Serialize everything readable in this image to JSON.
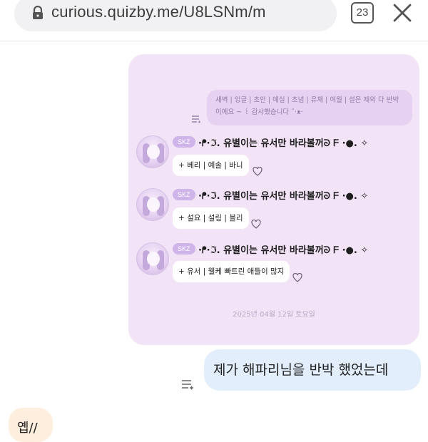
{
  "browser": {
    "url": "curious.quizby.me/U8LSNm/m",
    "tab_count": "23"
  },
  "attachment": {
    "top_bubble_text": "새벽 | 잉글 | 초안 | 예실 | 초념 | 유채 | 여월 | 설은 제외 다 반박 이에요 ~ ꒰ 감사했습니다 ˘·ᴥ·",
    "messages": [
      {
        "badge": "SKZ",
        "nickname": "·ᖰ·ℑ. 유별이는 유서만 바라볼꺼ᘐ ᖴ ·●. ✧",
        "reply": "+ 베리 | 예솔 | 바니"
      },
      {
        "badge": "SKZ",
        "nickname": "·ᖰ·ℑ. 유별이는 유서만 바라볼꺼ᘐ ᖴ ·●. ✧",
        "reply": "+ 설요 | 설링 | 블리"
      },
      {
        "badge": "SKZ",
        "nickname": "·ᖰ·ℑ. 유별이는 유서만 바라볼꺼ᘐ ᖴ ·●. ✧",
        "reply": "+ 유서 | 웰케 빠트린 애들이 많지"
      }
    ],
    "date": "2025년 04월 12일 토요일"
  },
  "chat": {
    "my_message": "제가 해파리님을 반박 했었는데",
    "their_message": "옙//"
  },
  "colors": {
    "card_bg": "#f3e3f7",
    "badge": "#cfb4ea",
    "my_bubble": "#e2eefc",
    "their_bubble": "#fdeedd"
  },
  "icons": [
    "lock-icon",
    "close-icon",
    "menu-icon",
    "heart-icon",
    "avatar"
  ]
}
